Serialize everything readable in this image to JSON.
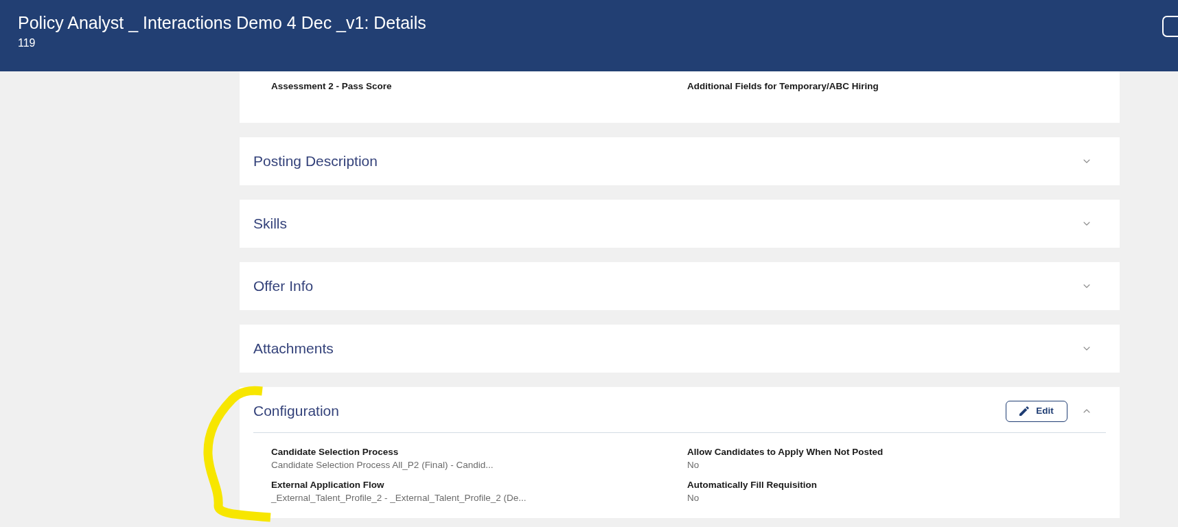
{
  "header": {
    "title": "Policy Analyst _ Interactions Demo 4 Dec _v1: Details",
    "subtitle": "119"
  },
  "summary_card": {
    "fields": [
      {
        "label": "Assessment 2 - Pass Score"
      },
      {
        "label": "Additional Fields for Temporary/ABC Hiring"
      }
    ]
  },
  "sections": [
    {
      "title": "Posting Description",
      "expanded": false
    },
    {
      "title": "Skills",
      "expanded": false
    },
    {
      "title": "Offer Info",
      "expanded": false
    },
    {
      "title": "Attachments",
      "expanded": false
    },
    {
      "title": "Configuration",
      "expanded": true,
      "edit_button": "Edit",
      "fields": [
        {
          "label": "Candidate Selection Process",
          "value": "Candidate Selection Process All_P2 (Final) - Candid..."
        },
        {
          "label": "Allow Candidates to Apply When Not Posted",
          "value": "No"
        },
        {
          "label": "External Application Flow",
          "value": "_External_Talent_Profile_2 - _External_Talent_Profile_2 (De..."
        },
        {
          "label": "Automatically Fill Requisition",
          "value": "No"
        }
      ]
    }
  ]
}
